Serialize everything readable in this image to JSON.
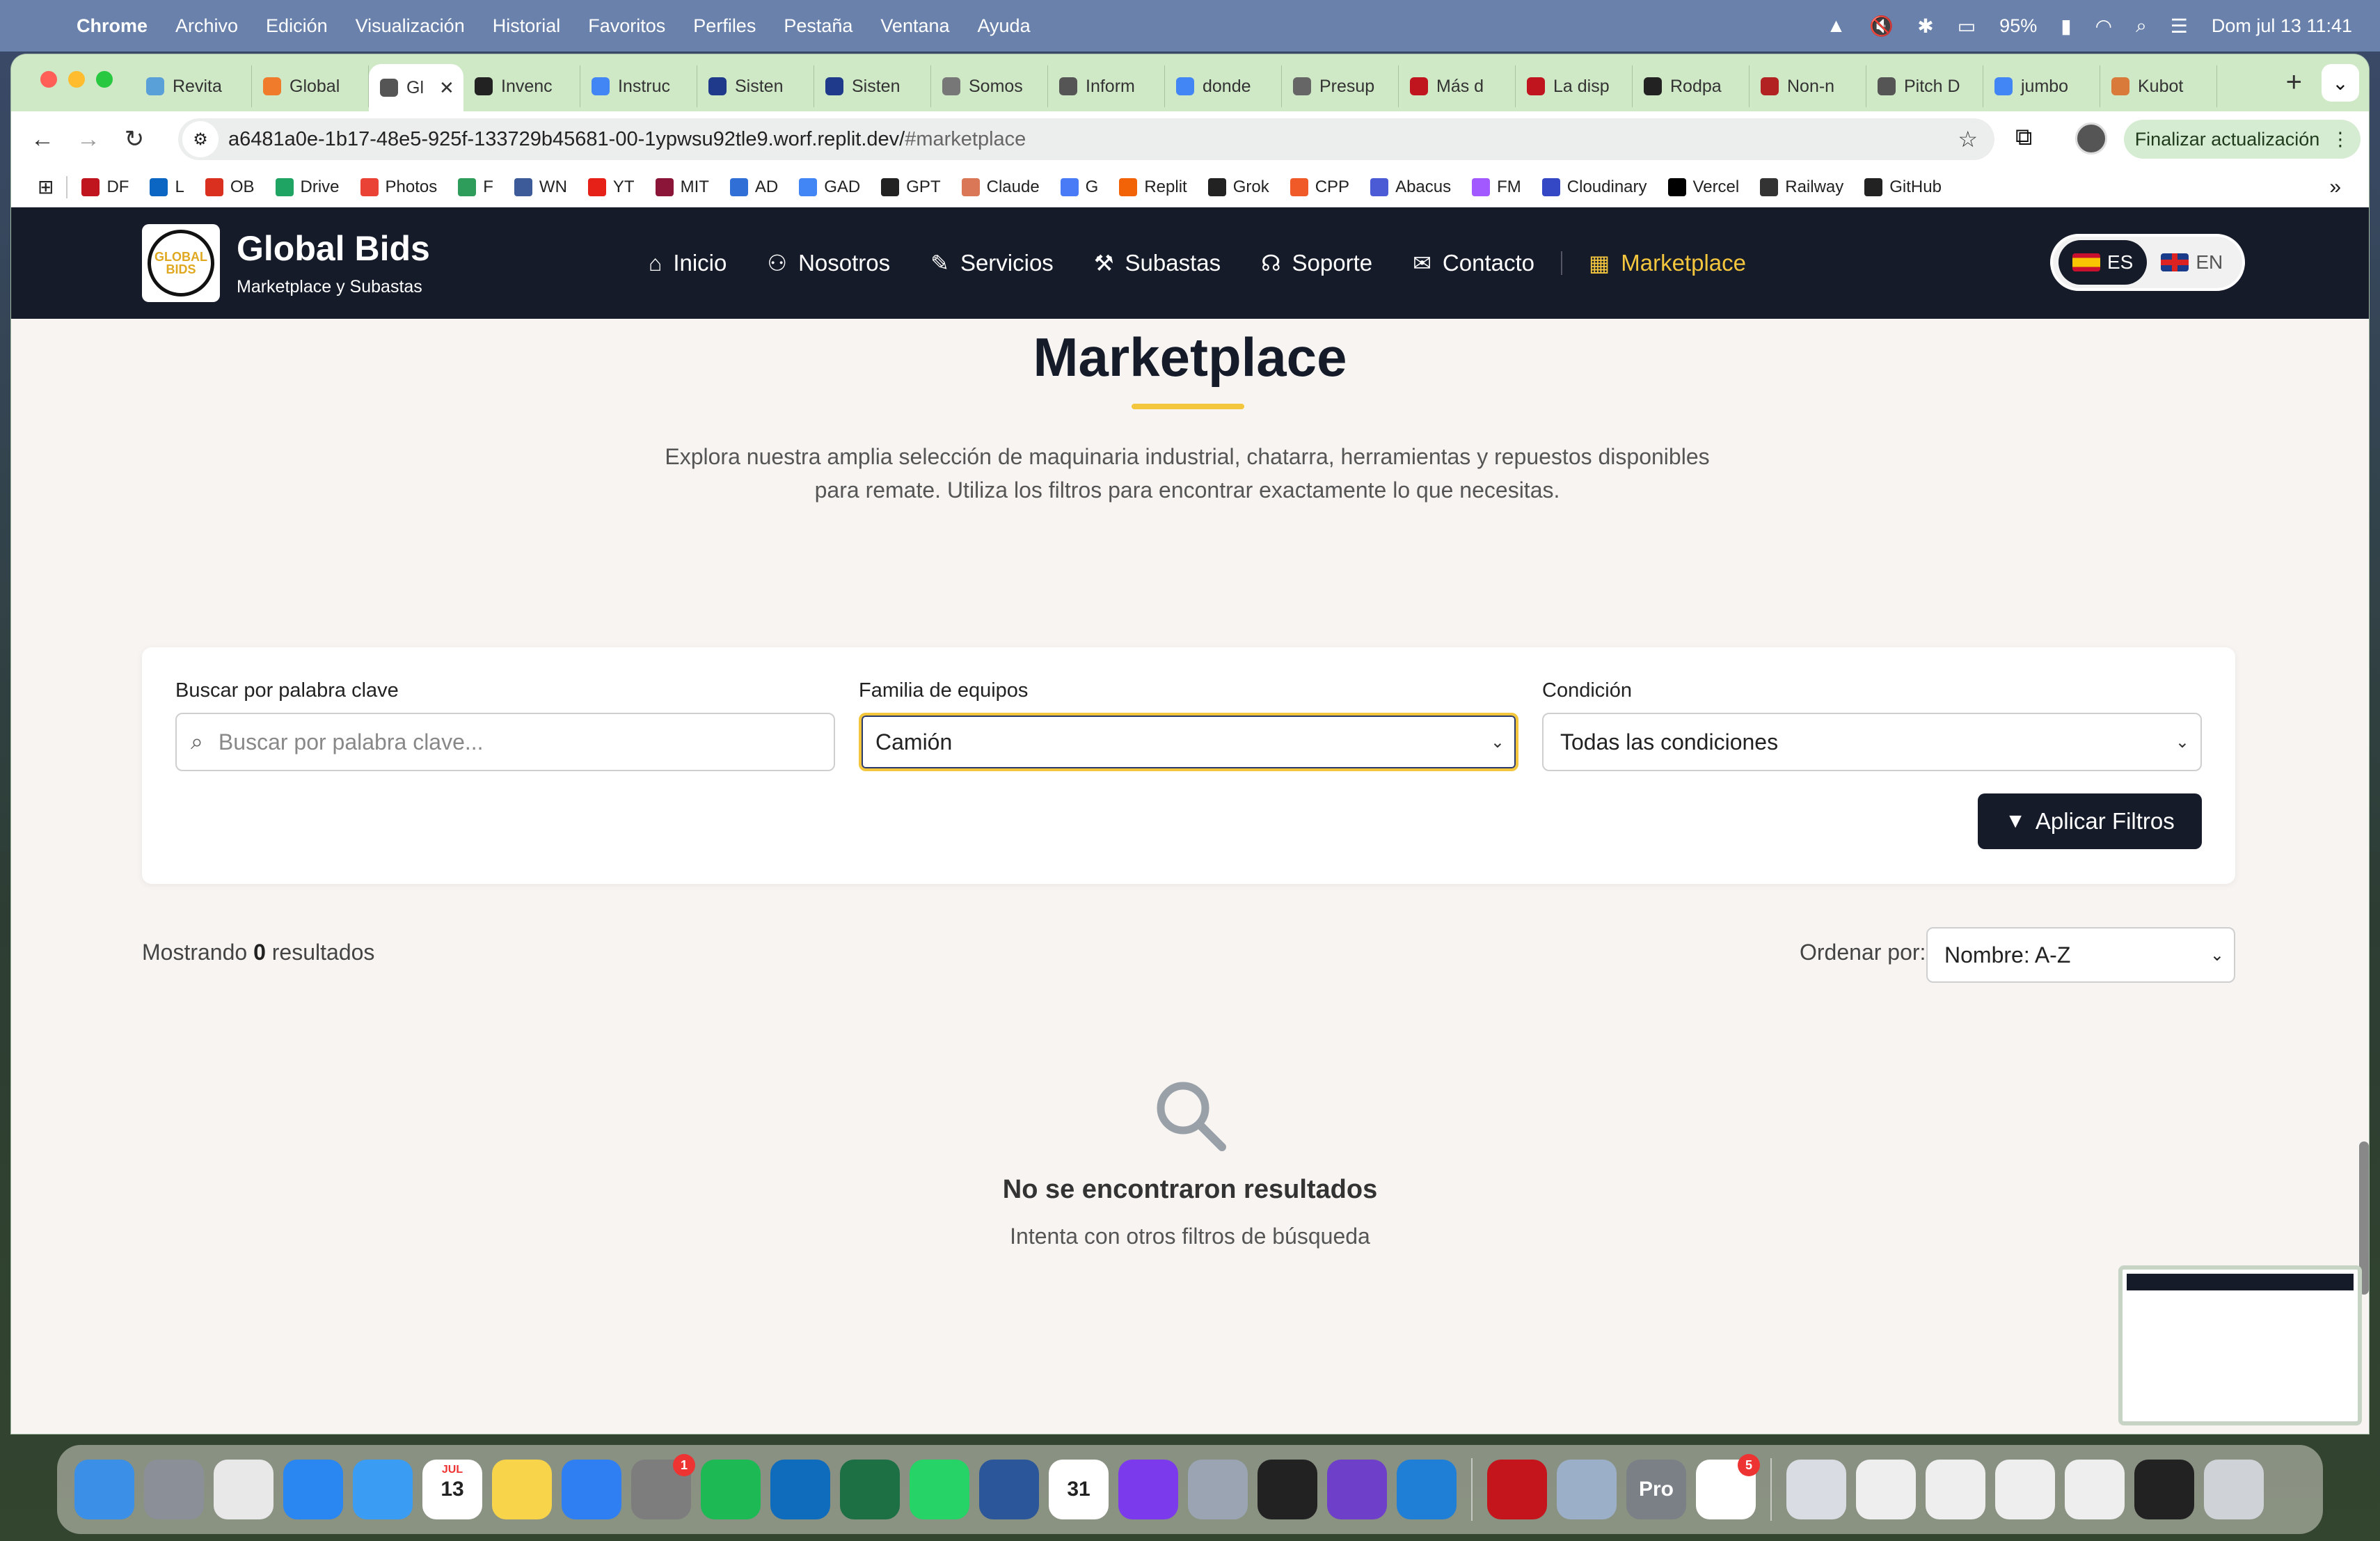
{
  "menubar": {
    "app": "Chrome",
    "items": [
      "Archivo",
      "Edición",
      "Visualización",
      "Historial",
      "Favoritos",
      "Perfiles",
      "Pestaña",
      "Ventana",
      "Ayuda"
    ],
    "battery": "95%",
    "datetime": "Dom jul 13  11:41"
  },
  "tabs": [
    {
      "label": "Revita",
      "color": "#5aa0d8"
    },
    {
      "label": "Global",
      "color": "#f07b2a"
    },
    {
      "label": "Gl",
      "color": "#555555",
      "active": true
    },
    {
      "label": "Invenc",
      "color": "#222222"
    },
    {
      "label": "Instruc",
      "color": "#4285f4"
    },
    {
      "label": "Sisten",
      "color": "#1f3a8a"
    },
    {
      "label": "Sisten",
      "color": "#1f3a8a"
    },
    {
      "label": "Somos",
      "color": "#777777"
    },
    {
      "label": "Inform",
      "color": "#555555"
    },
    {
      "label": "donde",
      "color": "#4285f4"
    },
    {
      "label": "Presup",
      "color": "#666666"
    },
    {
      "label": "Más d",
      "color": "#c0151e"
    },
    {
      "label": "La disp",
      "color": "#c0151e"
    },
    {
      "label": "Rodpa",
      "color": "#222222"
    },
    {
      "label": "Non-n",
      "color": "#b22222"
    },
    {
      "label": "Pitch D",
      "color": "#555555"
    },
    {
      "label": "jumbo",
      "color": "#4285f4"
    },
    {
      "label": "Kubot",
      "color": "#d97a3a"
    }
  ],
  "toolbar": {
    "url_main": "a6481a0e-1b17-48e5-925f-133729b45681-00-1ypwsu92tle9.worf.replit.dev/",
    "url_hash": "#marketplace",
    "update_label": "Finalizar actualización"
  },
  "bookmarks": [
    {
      "label": "DF",
      "color": "#c0151e"
    },
    {
      "label": "L",
      "color": "#0a66c2"
    },
    {
      "label": "OB",
      "color": "#d9301f"
    },
    {
      "label": "Drive",
      "color": "#1fa463"
    },
    {
      "label": "Photos",
      "color": "#ea4335"
    },
    {
      "label": "F",
      "color": "#2e9d5b"
    },
    {
      "label": "WN",
      "color": "#3d5a99"
    },
    {
      "label": "YT",
      "color": "#e62117"
    },
    {
      "label": "MIT",
      "color": "#8a1538"
    },
    {
      "label": "AD",
      "color": "#2f6fd6"
    },
    {
      "label": "GAD",
      "color": "#4285f4"
    },
    {
      "label": "GPT",
      "color": "#222222"
    },
    {
      "label": "Claude",
      "color": "#d97757"
    },
    {
      "label": "G",
      "color": "#4a7bf7"
    },
    {
      "label": "Replit",
      "color": "#f26207"
    },
    {
      "label": "Grok",
      "color": "#222222"
    },
    {
      "label": "CPP",
      "color": "#f05a28"
    },
    {
      "label": "Abacus",
      "color": "#4b5bd6"
    },
    {
      "label": "FM",
      "color": "#a259ff"
    },
    {
      "label": "Cloudinary",
      "color": "#3448c5"
    },
    {
      "label": "Vercel",
      "color": "#000000"
    },
    {
      "label": "Railway",
      "color": "#333333"
    },
    {
      "label": "GitHub",
      "color": "#222222"
    }
  ],
  "site": {
    "brand_title": "Global Bids",
    "brand_subtitle": "Marketplace y Subastas",
    "logo_text": "GLOBAL BIDS",
    "nav": [
      {
        "label": "Inicio",
        "icon": "home-icon",
        "glyph": "⌂"
      },
      {
        "label": "Nosotros",
        "icon": "users-icon",
        "glyph": "👥"
      },
      {
        "label": "Servicios",
        "icon": "wrench-icon",
        "glyph": "🔧"
      },
      {
        "label": "Subastas",
        "icon": "gavel-icon",
        "glyph": "🔨"
      },
      {
        "label": "Soporte",
        "icon": "headset-icon",
        "glyph": "🎧"
      },
      {
        "label": "Contacto",
        "icon": "envelope-icon",
        "glyph": "✉"
      },
      {
        "label": "Marketplace",
        "icon": "grid-icon",
        "glyph": "▦",
        "active": true
      }
    ],
    "lang_es": "ES",
    "lang_en": "EN",
    "accent": "#f4c63e",
    "dark": "#151b29"
  },
  "page": {
    "title": "Marketplace",
    "intro_line1": "Explora nuestra amplia selección de maquinaria industrial, chatarra, herramientas y repuestos disponibles",
    "intro_line2": "para remate. Utiliza los filtros para encontrar exactamente lo que necesitas."
  },
  "filters": {
    "keyword_label": "Buscar por palabra clave",
    "keyword_placeholder": "Buscar por palabra clave...",
    "family_label": "Familia de equipos",
    "family_value": "Camión",
    "condition_label": "Condición",
    "condition_value": "Todas las condiciones",
    "apply_label": "Aplicar Filtros"
  },
  "results": {
    "prefix": "Mostrando",
    "count": "0",
    "suffix": "resultados",
    "sort_label": "Ordenar por:",
    "sort_value": "Nombre: A-Z",
    "empty_title": "No se encontraron resultados",
    "empty_sub": "Intenta con otros filtros de búsqueda"
  },
  "dock": [
    {
      "name": "finder",
      "color": "#3b8fe6"
    },
    {
      "name": "launchpad",
      "color": "#8a8f98"
    },
    {
      "name": "chrome",
      "color": "#e8e8e8"
    },
    {
      "name": "safari",
      "color": "#2a86f0"
    },
    {
      "name": "mail",
      "color": "#3a9cf2"
    },
    {
      "name": "calendar",
      "color": "#ffffff",
      "text": "13",
      "subtext": "JUL"
    },
    {
      "name": "notes",
      "color": "#f7d44a"
    },
    {
      "name": "keynote",
      "color": "#2f7ff2"
    },
    {
      "name": "system-settings",
      "color": "#7d7d7d",
      "badge": "1"
    },
    {
      "name": "spotify",
      "color": "#1db954"
    },
    {
      "name": "outlook",
      "color": "#0f6cbd"
    },
    {
      "name": "excel",
      "color": "#1d7044"
    },
    {
      "name": "whatsapp",
      "color": "#25d366"
    },
    {
      "name": "word",
      "color": "#2b579a"
    },
    {
      "name": "calendar-31",
      "color": "#ffffff",
      "text": "31"
    },
    {
      "name": "screen-recorder",
      "color": "#7c3aed"
    },
    {
      "name": "iphone-mirroring",
      "color": "#9aa4b2"
    },
    {
      "name": "app-dark",
      "color": "#222222"
    },
    {
      "name": "github-desktop",
      "color": "#6e40c9"
    },
    {
      "name": "vscode",
      "color": "#1f7fd6"
    },
    {
      "name": "acrobat",
      "color": "#c4141c"
    },
    {
      "name": "preview",
      "color": "#9bb0c8"
    },
    {
      "name": "pro-app",
      "color": "#7b7f86",
      "text": "Pro"
    },
    {
      "name": "app-store",
      "color": "#ffffff",
      "badge": "5"
    },
    {
      "name": "folder-docs",
      "color": "#d9dde3"
    },
    {
      "name": "doc-pdf",
      "color": "#eeeeee"
    },
    {
      "name": "doc-sheet",
      "color": "#eeeeee"
    },
    {
      "name": "doc-screenshot",
      "color": "#eeeeee"
    },
    {
      "name": "doc-sheet-2",
      "color": "#eeeeee"
    },
    {
      "name": "terminal",
      "color": "#222222"
    },
    {
      "name": "trash",
      "color": "#cfd3d8"
    }
  ]
}
